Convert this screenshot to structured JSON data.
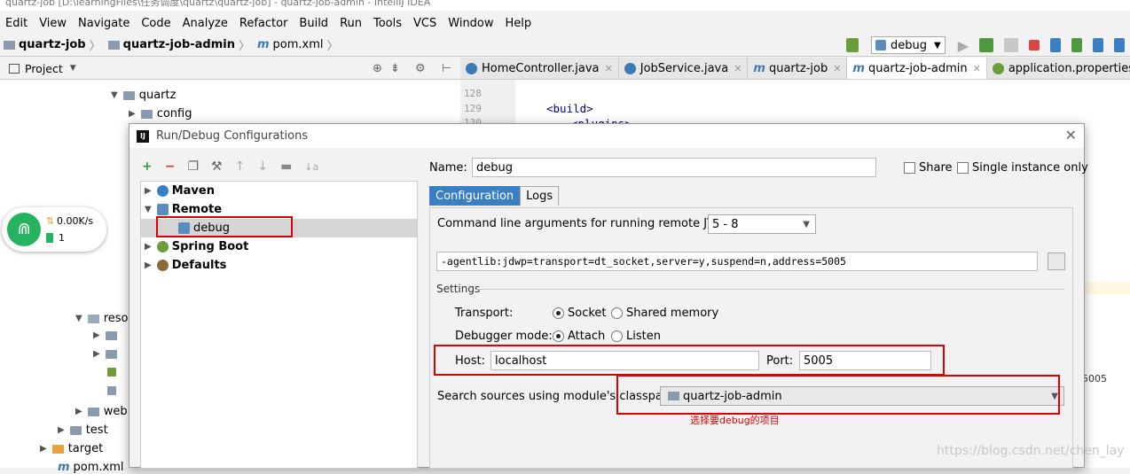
{
  "window": {
    "title": "quartz-job [D:\\learningFiles\\任务调度\\quartz\\quartz-job] - quartz-job-admin - IntelliJ IDEA"
  },
  "menu": [
    "Edit",
    "View",
    "Navigate",
    "Code",
    "Analyze",
    "Refactor",
    "Build",
    "Run",
    "Tools",
    "VCS",
    "Window",
    "Help"
  ],
  "breadcrumb": {
    "items": [
      "quartz-job",
      "quartz-job-admin",
      "pom.xml"
    ]
  },
  "run_config": {
    "selected": "debug"
  },
  "project_panel": {
    "label": "Project"
  },
  "tree": {
    "quartz": "quartz",
    "config": "config",
    "resources": "reso",
    "web": "web",
    "test": "test",
    "target": "target",
    "pom": "pom.xml"
  },
  "editor_tabs": [
    "HomeController.java",
    "JobService.java",
    "quartz-job",
    "quartz-job-admin",
    "application.properties"
  ],
  "editor": {
    "lines": [
      "128",
      "129",
      "130"
    ],
    "build_tag": "<build>",
    "plugins_tag": "<plugins>",
    "side_value": "5005"
  },
  "wifi": {
    "speed": "0.00K/s",
    "count": "1"
  },
  "dialog": {
    "title": "Run/Debug Configurations",
    "tree": {
      "maven": "Maven",
      "remote": "Remote",
      "debug": "debug",
      "spring_boot": "Spring Boot",
      "defaults": "Defaults"
    },
    "name_label": "Name:",
    "name_value": "debug",
    "share_label": "Share",
    "single_label": "Single instance only",
    "tabs": [
      "Configuration",
      "Logs"
    ],
    "cmd_label": "Command line arguments for running remote JVM",
    "jvm_version": "5 - 8",
    "cmd_value": "-agentlib:jdwp=transport=dt_socket,server=y,suspend=n,address=5005",
    "settings_label": "Settings",
    "transport_label": "Transport:",
    "socket": "Socket",
    "shared_memory": "Shared memory",
    "debugger_mode_label": "Debugger mode:",
    "attach": "Attach",
    "listen": "Listen",
    "host_label": "Host:",
    "host_value": "localhost",
    "port_label": "Port:",
    "port_value": "5005",
    "classpath_label": "Search sources using module's classpath:",
    "classpath_value": "quartz-job-admin",
    "annotation": "选择要debug的项目"
  },
  "watermark": "https://blog.csdn.net/chen_lay",
  "colors": {
    "accent": "#3a7fc4",
    "highlight": "#e00000",
    "wifi": "#25b35f"
  }
}
